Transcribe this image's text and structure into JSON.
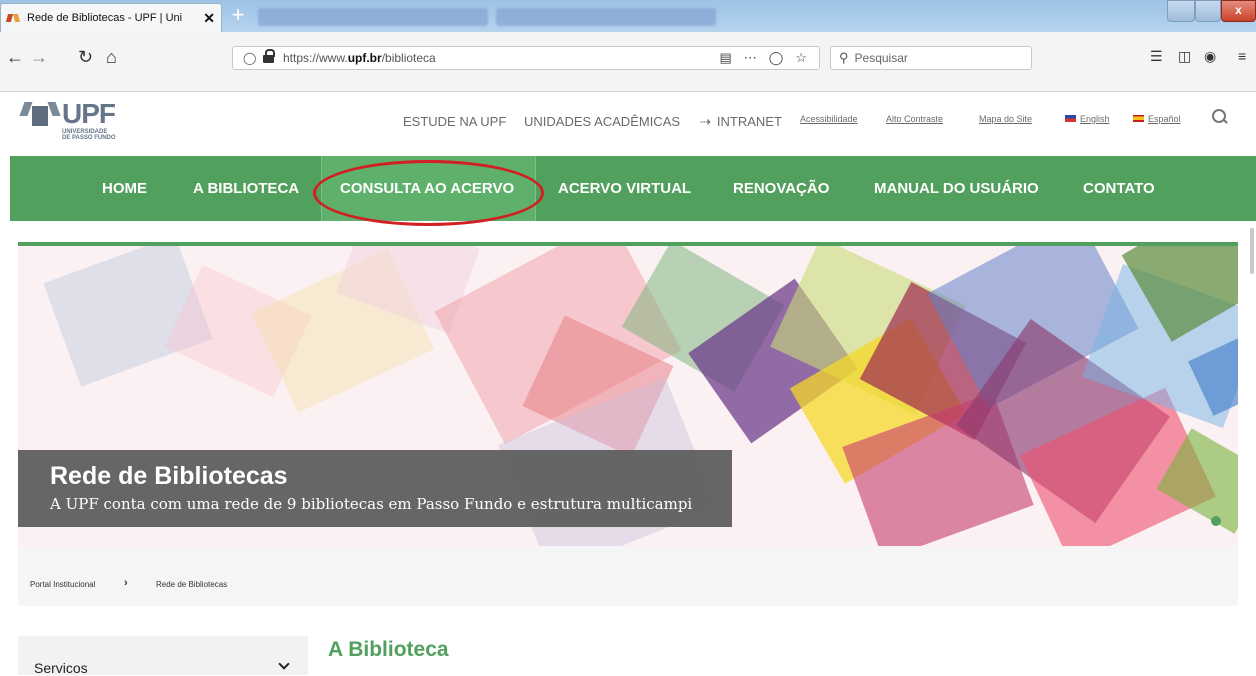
{
  "browser": {
    "tab_title": "Rede de Bibliotecas - UPF | Uni",
    "tab_close": "✕",
    "new_tab": "+",
    "url_prefix": "https://www.",
    "url_domain": "upf.br",
    "url_path": "/biblioteca",
    "search_placeholder": "Pesquisar",
    "icons": [
      "back-icon",
      "forward-icon",
      "reload-icon",
      "home-icon",
      "shield-icon",
      "lock-icon",
      "reader-icon",
      "more-icon",
      "pocket-icon",
      "bookmark-star-icon",
      "library-icon",
      "sidebar-icon",
      "account-icon",
      "menu-icon"
    ]
  },
  "site": {
    "logo_text": "UPF",
    "logo_sub1": "UNIVERSIDADE",
    "logo_sub2": "DE PASSO FUNDO",
    "toplinks": {
      "estude": "ESTUDE NA UPF",
      "unidades": "UNIDADES ACADÊMICAS",
      "intranet": "INTRANET",
      "acessibilidade": "Acessibilidade",
      "contraste": "Alto Contraste",
      "mapa": "Mapa do Site",
      "english": "English",
      "espanol": "Español"
    },
    "menu": {
      "home": "HOME",
      "biblioteca": "A BIBLIOTECA",
      "consulta": "CONSULTA AO ACERVO",
      "virtual": "ACERVO VIRTUAL",
      "renovacao": "RENOVAÇÃO",
      "manual": "MANUAL DO USUÁRIO",
      "contato": "CONTATO"
    },
    "accent_color": "#52a05d"
  },
  "banner": {
    "title": "Rede de Bibliotecas",
    "subtitle": "A UPF conta com uma rede de 9 bibliotecas em Passo Fundo e estrutura multicampi"
  },
  "breadcrumb": {
    "home": "Portal Institucional",
    "separator": "›",
    "current": "Rede de Bibliotecas"
  },
  "content": {
    "sidebar_label": "Servicos",
    "section_title": "A Biblioteca"
  }
}
